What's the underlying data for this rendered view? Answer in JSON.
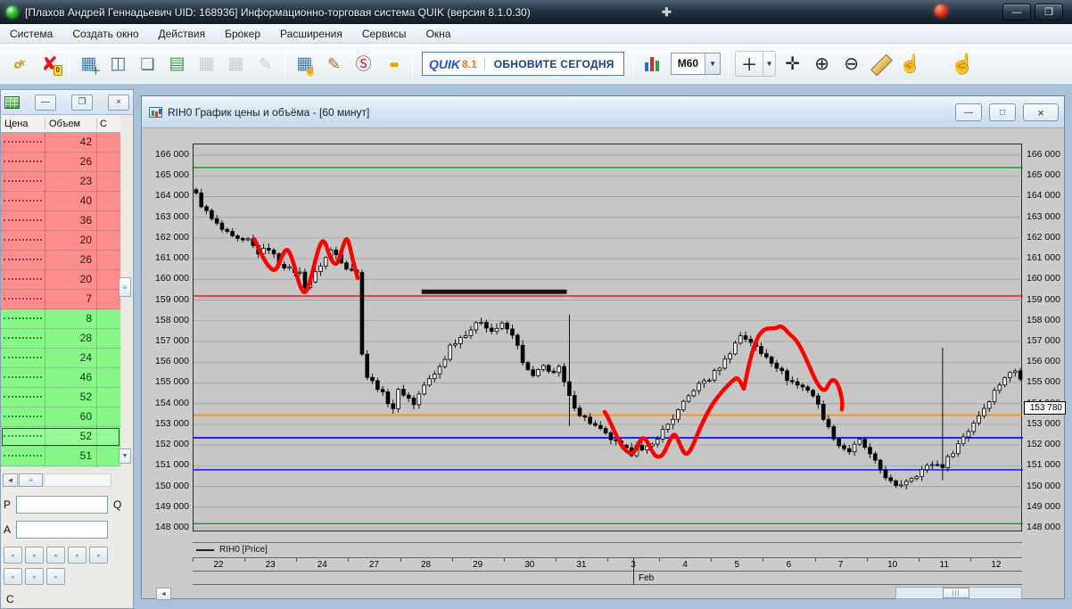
{
  "window": {
    "title": "[Плахов Андрей Геннадьевич UID: 168936] Информационно-торговая система QUIK (версия 8.1.0.30)",
    "controls": {
      "pin": "✚",
      "minimize": "—",
      "restore": "❐"
    }
  },
  "menu": {
    "items": [
      "Система",
      "Создать окно",
      "Действия",
      "Брокер",
      "Расширения",
      "Сервисы",
      "Окна"
    ]
  },
  "toolbar": {
    "quik_label": "QUIK",
    "quik_version": "8.1",
    "update_label": "ОБНОВИТЕ СЕГОДНЯ",
    "timeframe": "M60",
    "buttons": [
      {
        "type": "icon",
        "name": "key-icon",
        "css": "key"
      },
      {
        "type": "icon",
        "name": "disconnect-icon",
        "glyph": "✘",
        "color": "#e01818",
        "size": 22,
        "badge": "0"
      },
      {
        "type": "sep"
      },
      {
        "type": "icon",
        "name": "new-table-icon",
        "glyph": "▦",
        "color": "#3a7abf",
        "size": 19,
        "overlay": "＋",
        "overlayColor": "#18a018"
      },
      {
        "type": "icon",
        "name": "new-chart-icon",
        "glyph": "◫",
        "color": "#4a6a9a",
        "size": 19
      },
      {
        "type": "icon",
        "name": "new-window-icon",
        "glyph": "❏",
        "color": "#4a6a9a",
        "size": 18
      },
      {
        "type": "icon",
        "name": "quotes-table-icon",
        "glyph": "▤",
        "color": "#2f9e44",
        "size": 19
      },
      {
        "type": "icon",
        "name": "table-icon-1",
        "glyph": "▦",
        "color": "#8a96a2",
        "size": 19,
        "disabled": true
      },
      {
        "type": "icon",
        "name": "table-icon-2",
        "glyph": "▦",
        "color": "#8a96a2",
        "size": 19,
        "disabled": true
      },
      {
        "type": "icon",
        "name": "edit-table-icon",
        "glyph": "✎",
        "color": "#8a96a2",
        "size": 18,
        "disabled": true
      },
      {
        "type": "sep"
      },
      {
        "type": "icon",
        "name": "orders-table-icon",
        "glyph": "▦",
        "color": "#3a7abf",
        "size": 19,
        "overlay": "☝",
        "overlayColor": "#333333"
      },
      {
        "type": "icon",
        "name": "new-order-icon",
        "glyph": "✎",
        "color": "#b06820",
        "size": 18
      },
      {
        "type": "icon",
        "name": "stop-order-icon",
        "glyph": "Ⓢ",
        "color": "#d81e1e",
        "size": 18
      },
      {
        "type": "icon",
        "name": "money-icon",
        "glyph": "●●",
        "color": "#e0a800",
        "size": 12,
        "tight": true
      },
      {
        "type": "sep"
      },
      {
        "type": "quik-badge"
      },
      {
        "type": "sep"
      },
      {
        "type": "icon",
        "name": "chart-style-icon",
        "css": "bars"
      },
      {
        "type": "timeframe-select"
      },
      {
        "type": "sep"
      },
      {
        "type": "crosshair-tool"
      },
      {
        "type": "icon",
        "name": "move-tool-icon",
        "glyph": "✛",
        "color": "#222222",
        "size": 20
      },
      {
        "type": "icon",
        "name": "zoom-in-icon",
        "glyph": "⊕",
        "color": "#222222",
        "size": 20
      },
      {
        "type": "icon",
        "name": "zoom-out-icon",
        "glyph": "⊖",
        "color": "#222222",
        "size": 20
      },
      {
        "type": "icon",
        "name": "ruler-icon",
        "css": "ruler"
      },
      {
        "type": "icon",
        "name": "pointer-hand-icon",
        "glyph": "☝",
        "color": "#c09a60",
        "size": 20
      },
      {
        "type": "gap",
        "w": 26
      },
      {
        "type": "icon",
        "name": "pan-hand-icon",
        "glyph": "☝",
        "color": "#caa26a",
        "size": 22
      }
    ]
  },
  "orderbook": {
    "columns": [
      "Цена",
      "Объем",
      "С"
    ],
    "asks": [
      42,
      26,
      23,
      40,
      36,
      20,
      26,
      20,
      7
    ],
    "bids": [
      8,
      28,
      24,
      46,
      52,
      60,
      52,
      51
    ],
    "selected_bid_index": 6,
    "ask_color": "#ff8d8d",
    "bid_color": "#87f787",
    "p_label": "Р",
    "q_label": "Q",
    "a_label": "А",
    "c_label": "С",
    "quick_buttons_row1": 5,
    "quick_buttons_row2": 3
  },
  "chart_window": {
    "title": "RIH0 График цены и объёма - [60 минут]",
    "legend": "RIH0 [Price]",
    "price_tag": "153 780",
    "month_label": "Feb",
    "controls": {
      "minimize": "—",
      "maximize": "□",
      "close": "×"
    }
  },
  "chart_data": {
    "type": "candlestick",
    "symbol": "RIH0",
    "timeframe_minutes": 60,
    "y_min": 148000,
    "y_max": 166000,
    "y_step": 1000,
    "x_labels": [
      "22",
      "23",
      "24",
      "27",
      "28",
      "29",
      "30",
      "31",
      "3",
      "4",
      "5",
      "6",
      "7",
      "10",
      "11",
      "12"
    ],
    "n_candles": 160,
    "candles_per_day": 10,
    "last_price": 153780,
    "close_waypoints": [
      [
        0,
        164100
      ],
      [
        1,
        163600
      ],
      [
        3,
        162900
      ],
      [
        5,
        162400
      ],
      [
        7,
        162000
      ],
      [
        9,
        161800
      ],
      [
        10,
        161900
      ],
      [
        12,
        161300
      ],
      [
        14,
        161500
      ],
      [
        16,
        160800
      ],
      [
        18,
        160500
      ],
      [
        20,
        160300
      ],
      [
        21,
        159700
      ],
      [
        22,
        159900
      ],
      [
        24,
        160700
      ],
      [
        26,
        161400
      ],
      [
        27,
        161200
      ],
      [
        29,
        160600
      ],
      [
        30,
        160500
      ],
      [
        31,
        160300
      ],
      [
        32,
        156500
      ],
      [
        33,
        155300
      ],
      [
        35,
        154800
      ],
      [
        37,
        154100
      ],
      [
        38,
        153800
      ],
      [
        39,
        154600
      ],
      [
        40,
        154500
      ],
      [
        42,
        154000
      ],
      [
        44,
        154900
      ],
      [
        46,
        155400
      ],
      [
        48,
        156200
      ],
      [
        49,
        156800
      ],
      [
        50,
        157000
      ],
      [
        52,
        157400
      ],
      [
        54,
        157800
      ],
      [
        55,
        158000
      ],
      [
        57,
        157500
      ],
      [
        59,
        157800
      ],
      [
        60,
        157600
      ],
      [
        62,
        156900
      ],
      [
        63,
        155900
      ],
      [
        65,
        155300
      ],
      [
        67,
        155800
      ],
      [
        69,
        155500
      ],
      [
        70,
        155700
      ],
      [
        72,
        154300
      ],
      [
        74,
        153500
      ],
      [
        76,
        153100
      ],
      [
        78,
        152700
      ],
      [
        79,
        152500
      ],
      [
        80,
        152300
      ],
      [
        82,
        151900
      ],
      [
        84,
        151600
      ],
      [
        85,
        152100
      ],
      [
        86,
        151700
      ],
      [
        88,
        152000
      ],
      [
        89,
        152400
      ],
      [
        90,
        152700
      ],
      [
        92,
        153300
      ],
      [
        94,
        154000
      ],
      [
        96,
        154700
      ],
      [
        98,
        155100
      ],
      [
        99,
        155200
      ],
      [
        100,
        155500
      ],
      [
        102,
        156100
      ],
      [
        104,
        156900
      ],
      [
        105,
        157300
      ],
      [
        107,
        157000
      ],
      [
        109,
        156400
      ],
      [
        110,
        156300
      ],
      [
        112,
        155800
      ],
      [
        114,
        155200
      ],
      [
        116,
        154900
      ],
      [
        118,
        154700
      ],
      [
        119,
        154400
      ],
      [
        120,
        153900
      ],
      [
        122,
        152800
      ],
      [
        124,
        152000
      ],
      [
        126,
        151700
      ],
      [
        128,
        152200
      ],
      [
        129,
        151900
      ],
      [
        130,
        151500
      ],
      [
        132,
        150800
      ],
      [
        134,
        150200
      ],
      [
        135,
        149950
      ],
      [
        137,
        150300
      ],
      [
        139,
        150600
      ],
      [
        140,
        150800
      ],
      [
        142,
        151100
      ],
      [
        144,
        151000
      ],
      [
        146,
        151700
      ],
      [
        148,
        152400
      ],
      [
        149,
        152700
      ],
      [
        150,
        153100
      ],
      [
        152,
        153800
      ],
      [
        154,
        154600
      ],
      [
        156,
        155300
      ],
      [
        158,
        155600
      ],
      [
        159,
        155300
      ]
    ],
    "special_candles": [
      {
        "i": 72,
        "high": 158300,
        "low": 152900
      },
      {
        "i": 144,
        "high": 156700,
        "low": 150300
      }
    ],
    "h_lines": [
      {
        "price": 165400,
        "color": "#00a000",
        "w": 1.4
      },
      {
        "price": 159200,
        "color": "#ff2020",
        "w": 1.6
      },
      {
        "price": 153450,
        "color": "#ff9018",
        "w": 2
      },
      {
        "price": 152350,
        "color": "#2020ff",
        "w": 2
      },
      {
        "price": 150800,
        "color": "#2020ff",
        "w": 1.6
      },
      {
        "price": 148200,
        "color": "#00a000",
        "w": 1.4
      }
    ],
    "trend_segment": {
      "price": 159400,
      "i_from": 44,
      "i_to": 72,
      "color": "#161616",
      "w": 5
    }
  },
  "annotations": {
    "color": "#ff0000",
    "scribbles": [
      "M 68,106 C 74,118 80,134 88,140 C 94,144 96,130 101,122 C 105,115 107,118 111,130 C 115,142 118,159 123,165 C 128,170 132,147 138,125 C 142,110 145,103 149,114 C 152,123 155,133 159,134 C 163,135 166,116 170,108 C 173,102 175,113 179,131 L 184,150",
      "M 461,300 C 468,310 474,330 482,340 C 488,347 492,350 497,340 C 501,331 504,325 509,334 C 514,343 517,352 523,350 C 529,348 532,333 537,327 C 541,322 543,332 549,344 C 553,351 557,345 563,330 C 569,315 577,298 585,287 C 591,279 599,269 607,263 C 611,260 614,268 617,274 C 620,262 624,234 633,216 C 641,201 649,209 655,205 C 661,201 665,211 671,215 C 679,221 687,241 695,259 C 701,272 707,281 711,271 C 715,263 719,261 723,271 C 727,281 728,290 727,297"
    ]
  }
}
